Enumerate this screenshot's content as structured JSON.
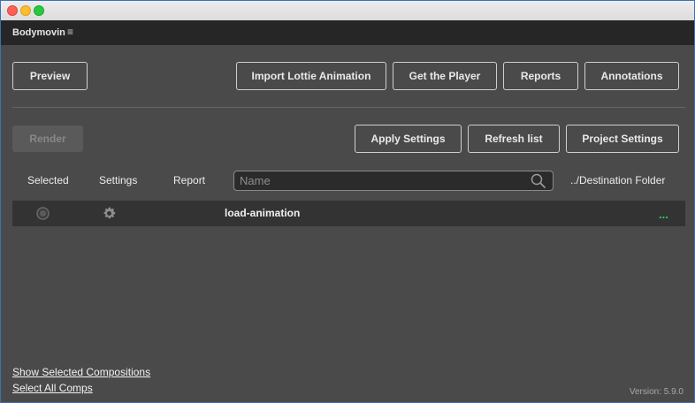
{
  "panel": {
    "title": "Bodymovin",
    "menu_icon": "hamburger-menu-icon",
    "menu_glyph": "≡"
  },
  "toolbar_top": {
    "preview": "Preview",
    "import_lottie": "Import Lottie Animation",
    "get_player": "Get the Player",
    "reports": "Reports",
    "annotations": "Annotations"
  },
  "toolbar_second": {
    "render": "Render",
    "apply_settings": "Apply Settings",
    "refresh_list": "Refresh list",
    "project_settings": "Project Settings"
  },
  "columns": {
    "selected": "Selected",
    "settings": "Settings",
    "report": "Report",
    "destination": "../Destination Folder"
  },
  "search": {
    "placeholder": "Name",
    "value": ""
  },
  "compositions": [
    {
      "name": "load-animation",
      "selected": false,
      "more_glyph": "..."
    }
  ],
  "footer": {
    "show_selected": "Show Selected Compositions",
    "select_all": "Select All Comps",
    "version": "Version: 5.9.0"
  },
  "colors": {
    "panel_bg": "#4a4a4a",
    "header_bg": "#262626",
    "row_bg": "#333333",
    "accent_green": "#2fd05a"
  }
}
